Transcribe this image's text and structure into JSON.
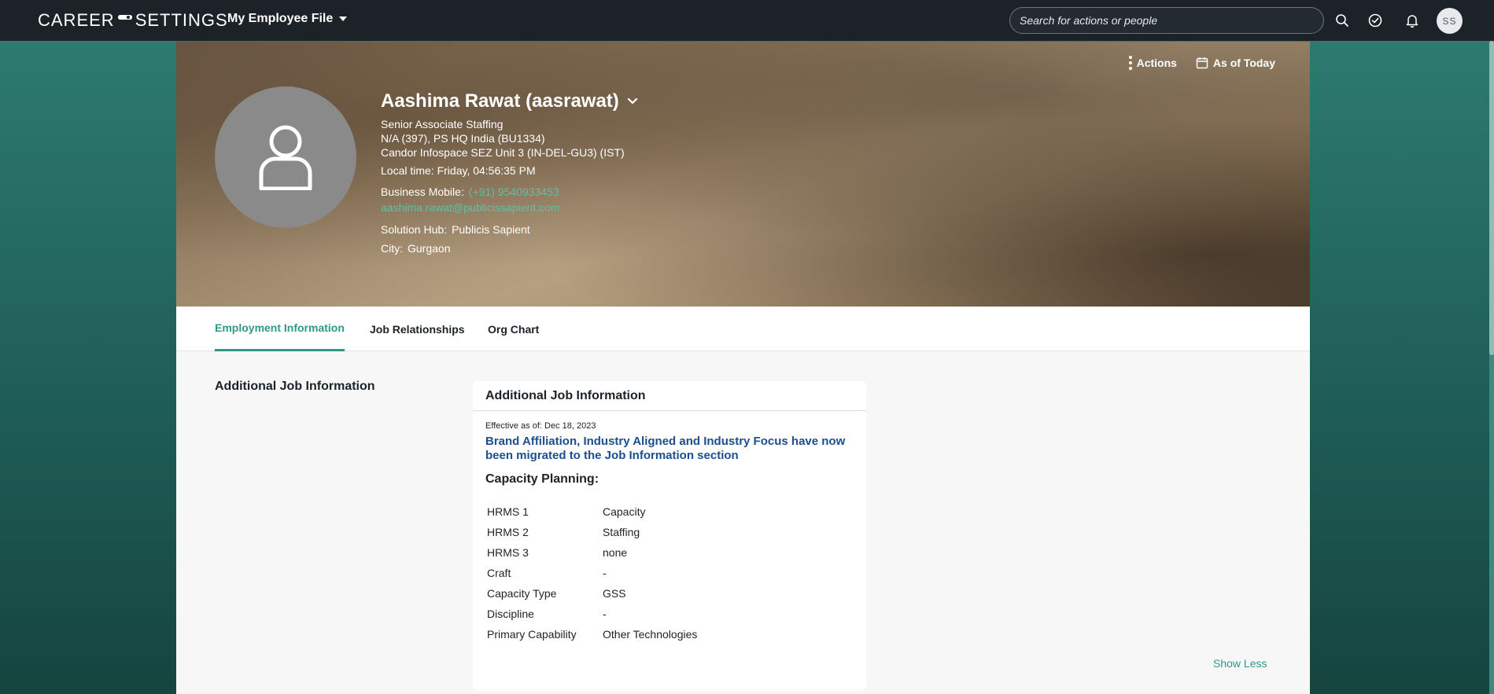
{
  "topbar": {
    "logo_left": "CAREER",
    "logo_right": "SETTINGS",
    "file_menu": "My Employee File",
    "search_placeholder": "Search for actions or people",
    "avatar_initials": "SS",
    "icons": [
      "search-icon",
      "check-circle-icon",
      "bell-icon"
    ]
  },
  "header": {
    "actions_label": "Actions",
    "as_of_label": "As of Today",
    "name": "Aashima Rawat (aasrawat)",
    "title": "Senior Associate Staffing",
    "org": "N/A (397), PS HQ India (BU1334)",
    "location": "Candor Infospace SEZ Unit 3 (IN-DEL-GU3) (IST)",
    "local_time": "Local time: Friday, 04:56:35 PM",
    "mobile_label": "Business Mobile:",
    "mobile_value": "(+91) 9540933453",
    "email": "aashima.rawat@publicissapient.com",
    "hub_label": "Solution Hub:",
    "hub_value": "Publicis Sapient",
    "city_label": "City:",
    "city_value": "Gurgaon"
  },
  "tabs": [
    "Employment Information",
    "Job Relationships",
    "Org Chart"
  ],
  "section": {
    "title": "Additional Job Information"
  },
  "card": {
    "title": "Additional Job Information",
    "effective": "Effective as of: Dec 18, 2023",
    "notice": "Brand Affiliation, Industry Aligned and Industry Focus have now been migrated to the Job Information section",
    "capacity_title": "Capacity Planning:",
    "rows": [
      {
        "key": "HRMS 1",
        "value": "Capacity"
      },
      {
        "key": "HRMS 2",
        "value": "Staffing"
      },
      {
        "key": "HRMS 3",
        "value": "none"
      },
      {
        "key": "Craft",
        "value": "-"
      },
      {
        "key": "Capacity Type",
        "value": "GSS"
      },
      {
        "key": "Discipline",
        "value": "-"
      },
      {
        "key": "Primary Capability",
        "value": "Other Technologies"
      }
    ]
  },
  "show_less": "Show Less",
  "colors": {
    "accent": "#2e9a86",
    "link_blue": "#1d4e8f",
    "topbar": "#1c2228"
  }
}
